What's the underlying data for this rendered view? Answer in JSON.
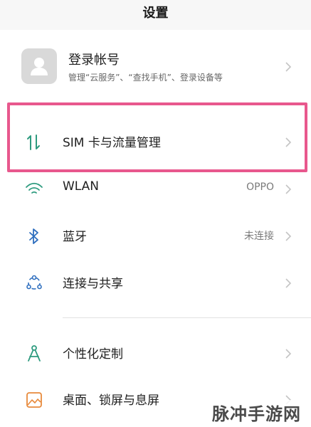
{
  "header": {
    "title": "设置"
  },
  "account": {
    "title": "登录帐号",
    "subtitle": "管理“云服务”、“查找手机”、登录设备等"
  },
  "items": [
    {
      "label": "SIM 卡与流量管理",
      "value": "",
      "icon": "data-transfer-icon"
    },
    {
      "label": "WLAN",
      "value": "OPPO",
      "icon": "wifi-icon"
    },
    {
      "label": "蓝牙",
      "value": "未连接",
      "icon": "bluetooth-icon"
    },
    {
      "label": "连接与共享",
      "value": "",
      "icon": "share-network-icon"
    },
    {
      "label": "个性化定制",
      "value": "",
      "icon": "compass-icon"
    },
    {
      "label": "桌面、锁屏与息屏",
      "value": "",
      "icon": "wallpaper-icon"
    }
  ],
  "watermark": "脉冲手游网",
  "colors": {
    "highlight": "#e8588d",
    "accent_green": "#2e9b7f",
    "icon_blue": "#2f6fbf"
  }
}
